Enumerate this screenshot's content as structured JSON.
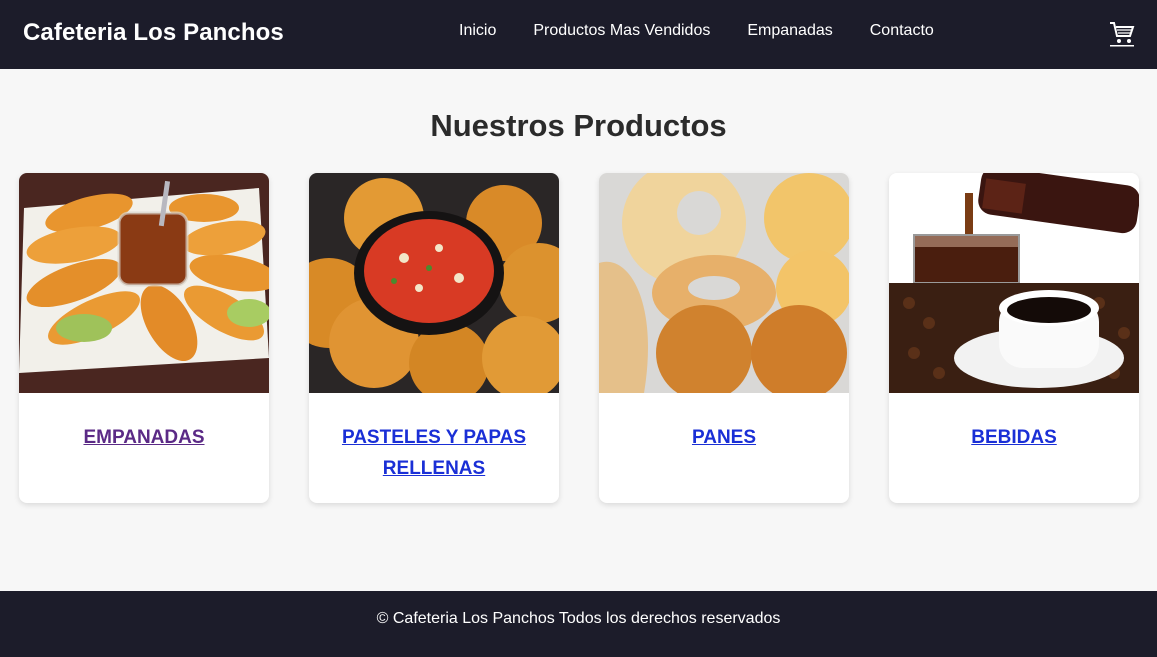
{
  "header": {
    "brand": "Cafeteria Los Panchos",
    "nav": [
      "Inicio",
      "Productos Mas Vendidos",
      "Empanadas",
      "Contacto"
    ],
    "cart_icon": "shopping-cart-icon"
  },
  "main": {
    "title": "Nuestros Productos",
    "products": [
      {
        "label": "EMPANADAS",
        "image": "empanadas-photo"
      },
      {
        "label": "PASTELES Y PAPAS RELLENAS",
        "image": "pasteles-photo"
      },
      {
        "label": "PANES",
        "image": "panes-photo"
      },
      {
        "label": "BEBIDAS",
        "image": "bebidas-photo"
      }
    ]
  },
  "footer": {
    "copyright": "© Cafeteria Los Panchos Todos los derechos reservados"
  },
  "colors": {
    "header_bg": "#1c1c2a",
    "link": "#1a2fd6",
    "visited_link": "#5b2a86",
    "page_bg": "#f7f7f7"
  }
}
